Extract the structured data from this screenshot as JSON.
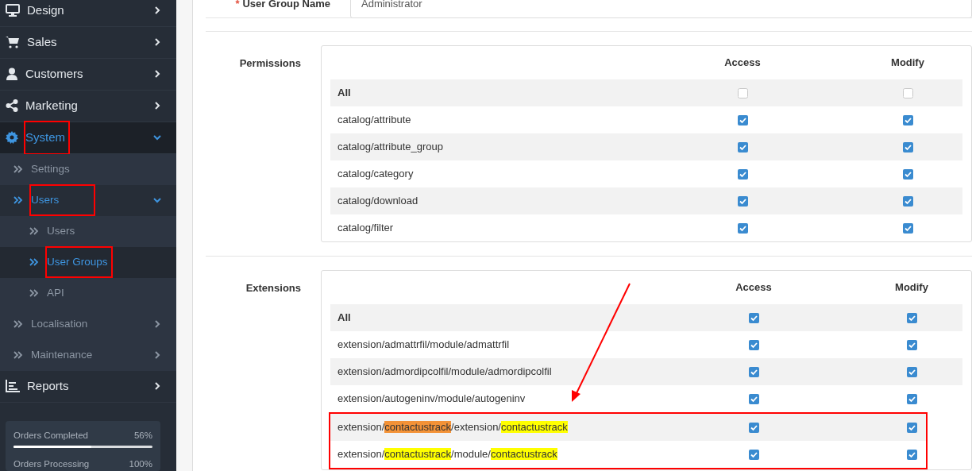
{
  "sidebar": {
    "items": [
      {
        "label": "Design",
        "expanded": false,
        "selected": false,
        "annotated": false
      },
      {
        "label": "Sales",
        "expanded": false,
        "selected": false,
        "annotated": false
      },
      {
        "label": "Customers",
        "expanded": false,
        "selected": false,
        "annotated": false
      },
      {
        "label": "Marketing",
        "expanded": false,
        "selected": false,
        "annotated": false
      },
      {
        "label": "System",
        "expanded": true,
        "selected": true,
        "annotated": true,
        "children": [
          {
            "label": "Settings",
            "selected": false,
            "annotated": false
          },
          {
            "label": "Users",
            "expanded": true,
            "selected": true,
            "annotated": true,
            "children": [
              {
                "label": "Users",
                "selected": false,
                "annotated": false
              },
              {
                "label": "User Groups",
                "selected": true,
                "annotated": true
              },
              {
                "label": "API",
                "selected": false,
                "annotated": false
              }
            ]
          },
          {
            "label": "Localisation",
            "expanded": false,
            "selected": false,
            "annotated": false
          },
          {
            "label": "Maintenance",
            "expanded": false,
            "selected": false,
            "annotated": false
          }
        ]
      },
      {
        "label": "Reports",
        "expanded": false,
        "selected": false,
        "annotated": false
      }
    ],
    "stats": [
      {
        "label": "Orders Completed",
        "reading": "56%",
        "level": 0.56
      },
      {
        "label": "Orders Processing",
        "reading": "100%"
      }
    ]
  },
  "form": {
    "name_field": {
      "required_mark": "*",
      "label": "User Group Name",
      "value": "Administrator"
    },
    "sections": [
      {
        "label": "Permissions",
        "columns": [
          "Access",
          "Modify"
        ],
        "rows": [
          {
            "segments": [
              {
                "text": "All"
              }
            ],
            "bold": true,
            "access": false,
            "modify": false,
            "annotated": false
          },
          {
            "segments": [
              {
                "text": "catalog/attribute"
              }
            ],
            "bold": false,
            "access": true,
            "modify": true,
            "annotated": false
          },
          {
            "segments": [
              {
                "text": "catalog/attribute_group"
              }
            ],
            "bold": false,
            "access": true,
            "modify": true,
            "annotated": false
          },
          {
            "segments": [
              {
                "text": "catalog/category"
              }
            ],
            "bold": false,
            "access": true,
            "modify": true,
            "annotated": false
          },
          {
            "segments": [
              {
                "text": "catalog/download"
              }
            ],
            "bold": false,
            "access": true,
            "modify": true,
            "annotated": false
          },
          {
            "segments": [
              {
                "text": "catalog/filter"
              }
            ],
            "bold": false,
            "access": true,
            "modify": true,
            "annotated": false
          }
        ]
      },
      {
        "label": "Extensions",
        "columns": [
          "Access",
          "Modify"
        ],
        "rows": [
          {
            "segments": [
              {
                "text": "All"
              }
            ],
            "bold": true,
            "access": true,
            "modify": true,
            "annotated": false
          },
          {
            "segments": [
              {
                "text": "extension/admattrfil/module/admattrfil"
              }
            ],
            "bold": false,
            "access": true,
            "modify": true,
            "annotated": false
          },
          {
            "segments": [
              {
                "text": "extension/admordipcolfil/module/admordipcolfil"
              }
            ],
            "bold": false,
            "access": true,
            "modify": true,
            "annotated": false
          },
          {
            "segments": [
              {
                "text": "extension/autogeninv/module/autogeninv"
              }
            ],
            "bold": false,
            "access": true,
            "modify": true,
            "annotated": false
          },
          {
            "segments": [
              {
                "text": "extension/"
              },
              {
                "text": "contactustrack",
                "highlighted": true,
                "current": true
              },
              {
                "text": "/extension/"
              },
              {
                "text": "contactustrack",
                "highlighted": true,
                "current": false
              }
            ],
            "bold": false,
            "access": true,
            "modify": true,
            "annotated": true
          },
          {
            "segments": [
              {
                "text": "extension/"
              },
              {
                "text": "contactustrack",
                "highlighted": true,
                "current": false
              },
              {
                "text": "/module/"
              },
              {
                "text": "contactustrack",
                "highlighted": true,
                "current": false
              }
            ],
            "bold": false,
            "access": true,
            "modify": true,
            "annotated": true
          }
        ]
      }
    ]
  }
}
